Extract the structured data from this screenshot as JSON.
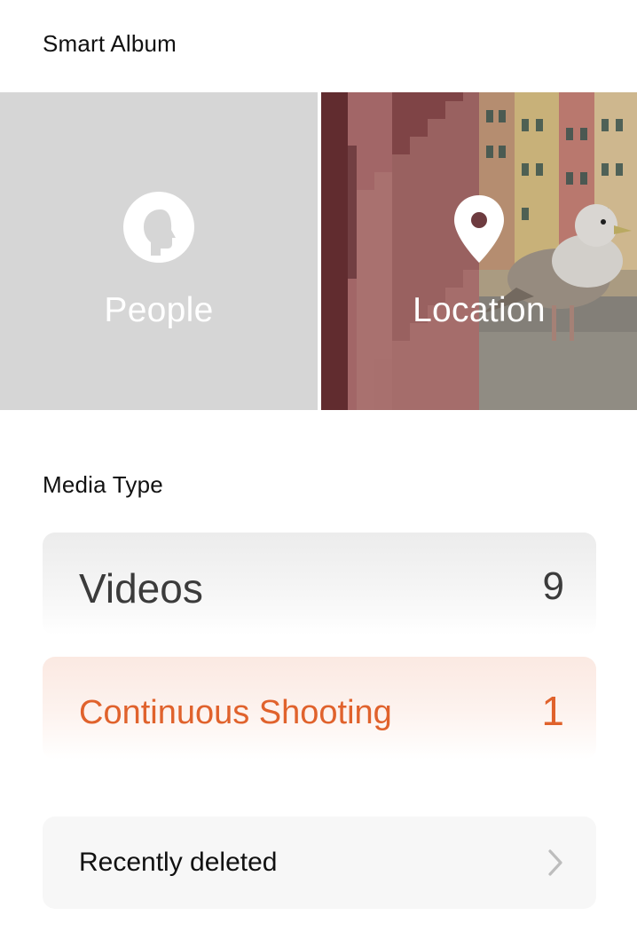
{
  "smart_album": {
    "title": "Smart Album",
    "tiles": [
      {
        "label": "People",
        "icon": "person-head-icon",
        "background": "#d6d6d6"
      },
      {
        "label": "Location",
        "icon": "location-pin-icon"
      }
    ]
  },
  "media_type": {
    "title": "Media Type",
    "items": [
      {
        "label": "Videos",
        "count": "9",
        "color": "#3b3b3b"
      },
      {
        "label": "Continuous Shooting",
        "count": "1",
        "color": "#e0622c"
      }
    ]
  },
  "recently_deleted": {
    "label": "Recently deleted",
    "icon": "chevron-right-icon"
  }
}
